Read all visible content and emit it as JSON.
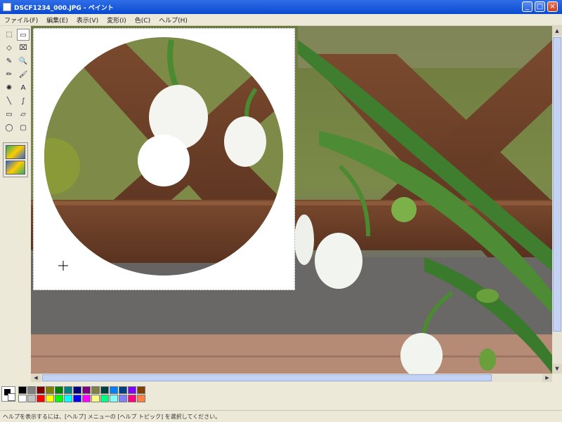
{
  "window": {
    "title": "DSCF1234_000.JPG - ペイント",
    "controls": [
      "_",
      "□",
      "×"
    ]
  },
  "menu": [
    "ファイル(F)",
    "編集(E)",
    "表示(V)",
    "変形(I)",
    "色(C)",
    "ヘルプ(H)"
  ],
  "tools": [
    "⬚",
    "▭",
    "◇",
    "⌧",
    "✎",
    "🔍",
    "✏",
    "🖌",
    "✺",
    "A",
    "╲",
    "∫",
    "▭",
    "▱",
    "◯",
    "▢"
  ],
  "status_text": "ヘルプを表示するには、[ヘルプ] メニューの [ヘルプ トピック] を選択してください。",
  "colors": {
    "row1": [
      "#000000",
      "#808080",
      "#800000",
      "#808000",
      "#008000",
      "#008080",
      "#000080",
      "#800080",
      "#808040",
      "#004040",
      "#0080ff",
      "#004080",
      "#8000ff",
      "#804000"
    ],
    "row2": [
      "#ffffff",
      "#c0c0c0",
      "#ff0000",
      "#ffff00",
      "#00ff00",
      "#00ffff",
      "#0000ff",
      "#ff00ff",
      "#ffff80",
      "#00ff80",
      "#80ffff",
      "#8080ff",
      "#ff0080",
      "#ff8040"
    ]
  }
}
